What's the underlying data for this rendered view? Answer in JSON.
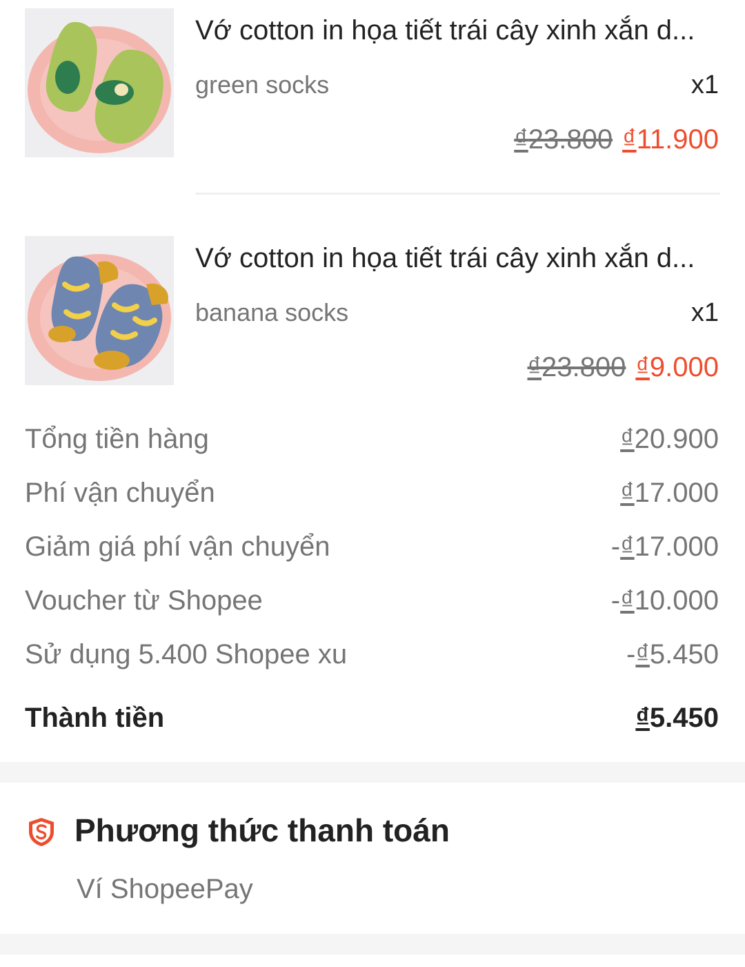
{
  "items": [
    {
      "title": "Vớ cotton in họa tiết trái cây xinh xắn d...",
      "variant": "green socks",
      "qty": "x1",
      "old_currency": "₫",
      "old_price": "23.800",
      "new_currency": "₫",
      "new_price": "11.900",
      "image": "avocado-socks-image"
    },
    {
      "title": "Vớ cotton in họa tiết trái cây xinh xắn d...",
      "variant": "banana socks",
      "qty": "x1",
      "old_currency": "₫",
      "old_price": "23.800",
      "new_currency": "₫",
      "new_price": "9.000",
      "image": "banana-socks-image"
    }
  ],
  "summary": [
    {
      "label": "Tổng tiền hàng",
      "prefix": "",
      "currency": "₫",
      "amount": "20.900"
    },
    {
      "label": "Phí vận chuyển",
      "prefix": "",
      "currency": "₫",
      "amount": "17.000"
    },
    {
      "label": "Giảm giá phí vận chuyển",
      "prefix": "-",
      "currency": "₫",
      "amount": "17.000"
    },
    {
      "label": "Voucher từ Shopee",
      "prefix": "-",
      "currency": "₫",
      "amount": "10.000"
    },
    {
      "label": "Sử dụng 5.400 Shopee xu",
      "prefix": "-",
      "currency": "₫",
      "amount": "5.450"
    }
  ],
  "total": {
    "label": "Thành tiền",
    "currency": "₫",
    "amount": "5.450"
  },
  "payment": {
    "title": "Phương thức thanh toán",
    "method": "Ví ShopeePay",
    "icon": "shopee-shield-icon"
  },
  "colors": {
    "accent": "#ee4d2d",
    "muted": "#757575",
    "text": "#222222",
    "band": "#f5f5f5"
  }
}
